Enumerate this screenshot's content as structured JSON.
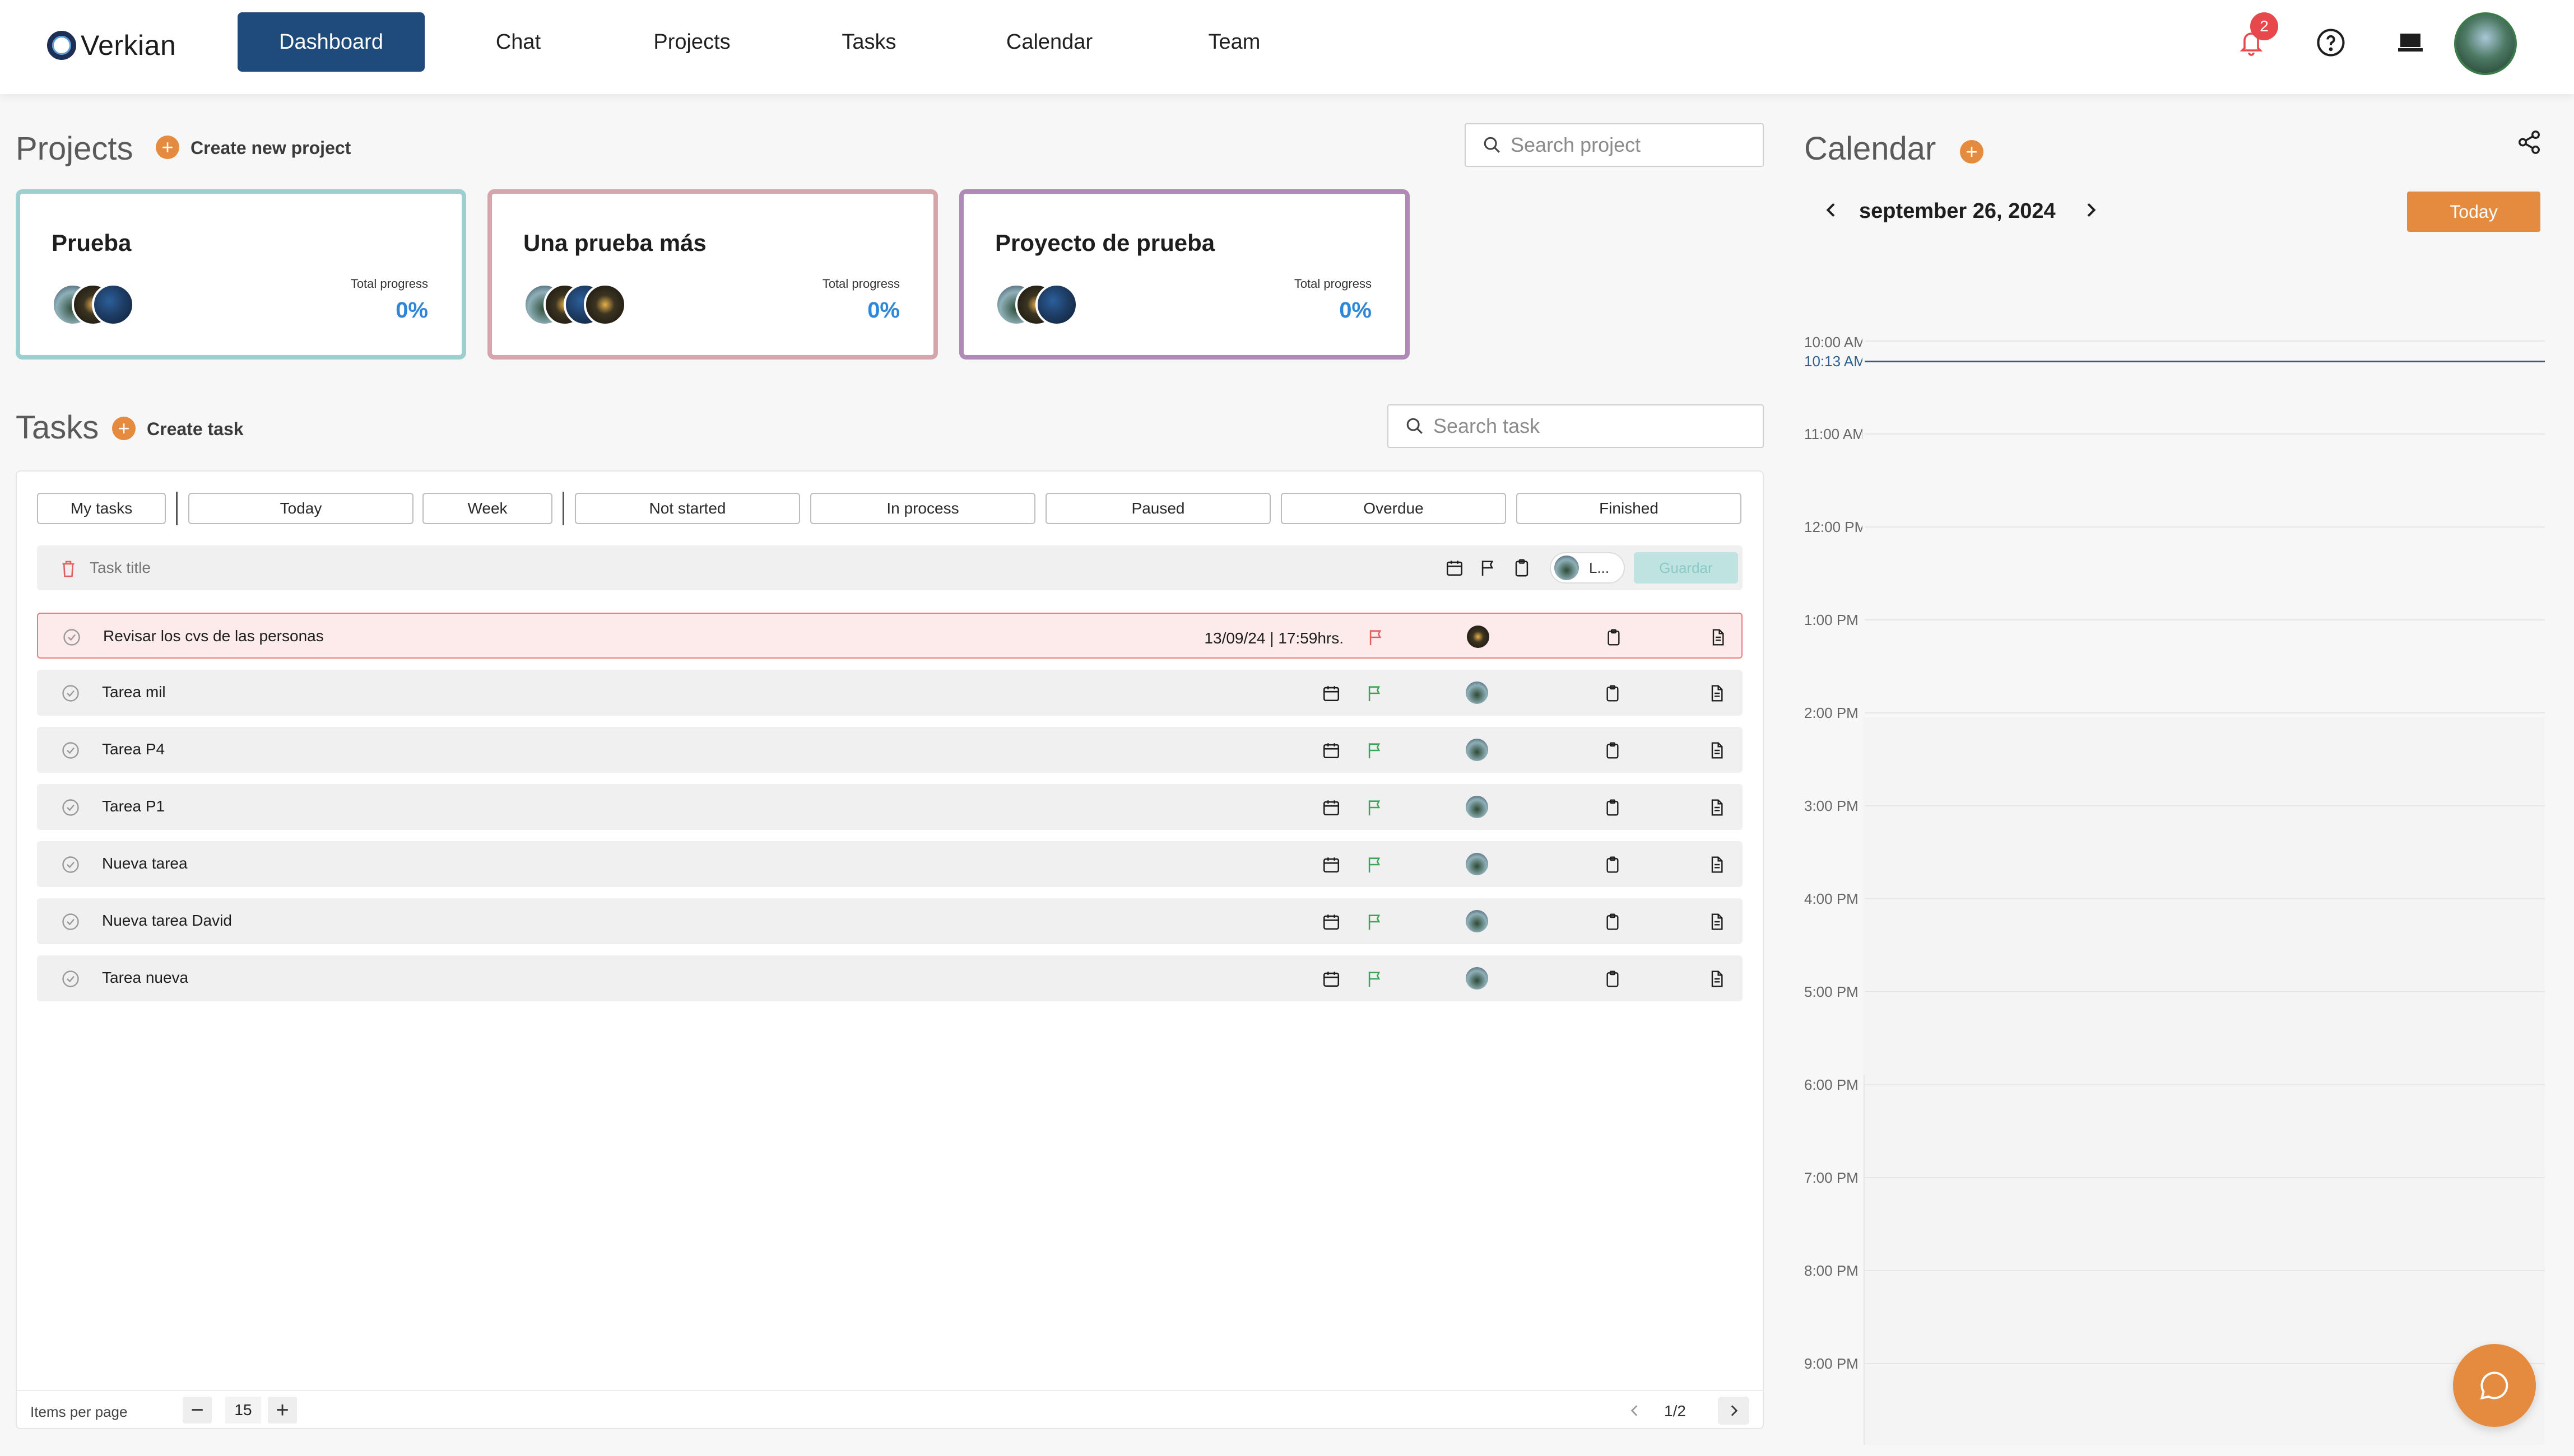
{
  "brand": {
    "name": "Verkian"
  },
  "nav": {
    "items": [
      "Dashboard",
      "Chat",
      "Projects",
      "Tasks",
      "Calendar",
      "Team"
    ],
    "active": "Dashboard",
    "notification_count": "2"
  },
  "projects": {
    "title": "Projects",
    "create_label": "Create new project",
    "search_placeholder": "Search project",
    "cards": [
      {
        "name": "Prueba",
        "progress_label": "Total progress",
        "progress_value": "0%",
        "border_color": "#9ecfcf"
      },
      {
        "name": "Una prueba más",
        "progress_label": "Total progress",
        "progress_value": "0%",
        "border_color": "#d4a6ab"
      },
      {
        "name": "Proyecto de prueba",
        "progress_label": "Total progress",
        "progress_value": "0%",
        "border_color": "#b08ab6"
      }
    ]
  },
  "tasks": {
    "title": "Tasks",
    "create_label": "Create task",
    "search_placeholder": "Search task",
    "filters": [
      "My tasks",
      "Today",
      "Week",
      "Not started",
      "In process",
      "Paused",
      "Overdue",
      "Finished"
    ],
    "new_task": {
      "placeholder": "Task title",
      "assignee_initial": "L...",
      "save_label": "Guardar"
    },
    "rows": [
      {
        "title": "Revisar los cvs de las personas",
        "date": "13/09/24 | 17:59hrs.",
        "overdue": true
      },
      {
        "title": "Tarea mil",
        "date": "",
        "overdue": false
      },
      {
        "title": "Tarea P4",
        "date": "",
        "overdue": false
      },
      {
        "title": "Tarea P1",
        "date": "",
        "overdue": false
      },
      {
        "title": "Nueva tarea",
        "date": "",
        "overdue": false
      },
      {
        "title": "Nueva tarea David",
        "date": "",
        "overdue": false
      },
      {
        "title": "Tarea nueva",
        "date": "",
        "overdue": false
      }
    ],
    "footer": {
      "items_per_page_label": "Items per page",
      "items_per_page": "15",
      "page_indicator": "1/2"
    }
  },
  "calendar": {
    "title": "Calendar",
    "date_label": "september 26, 2024",
    "today_label": "Today",
    "now_label": "10:13 AM",
    "hours": [
      "10:00 AM",
      "11:00 AM",
      "12:00 PM",
      "1:00 PM",
      "2:00 PM",
      "3:00 PM",
      "4:00 PM",
      "5:00 PM",
      "6:00 PM",
      "7:00 PM",
      "8:00 PM",
      "9:00 PM"
    ]
  },
  "colors": {
    "primary": "#1f4a7c",
    "accent": "#e58b3f",
    "link": "#2f86d6",
    "danger": "#e8484c",
    "flag_ok": "#3aa655",
    "flag_overdue": "#e06060"
  },
  "icons": {
    "bell": "bell-icon",
    "help": "help-icon",
    "monitor": "monitor-icon",
    "search": "search-icon",
    "calendar": "calendar-icon",
    "flag": "flag-icon",
    "clipboard": "clipboard-icon",
    "document": "document-icon",
    "check": "check-circle-icon",
    "trash": "trash-icon",
    "share": "share-icon",
    "chat": "chat-bubble-icon"
  }
}
